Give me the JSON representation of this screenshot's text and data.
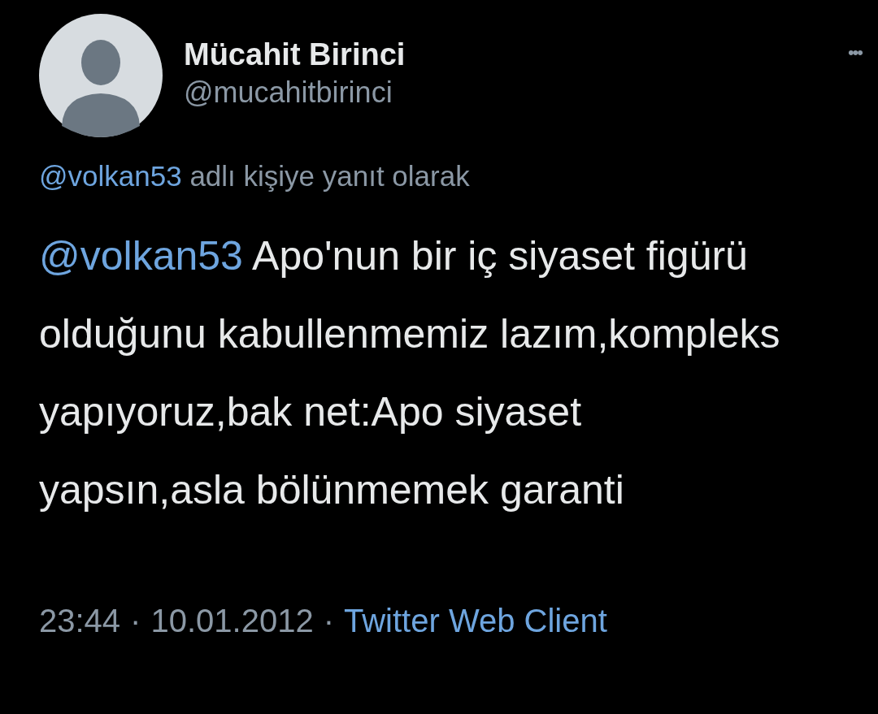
{
  "author": {
    "name": "Mücahit Birinci",
    "handle": "@mucahitbirinci"
  },
  "more": "•••",
  "reply_context": {
    "mention": "@volkan53",
    "text": "adlı kişiye yanıt olarak"
  },
  "tweet": {
    "mention": "@volkan53",
    "text": "Apo'nun bir iç siyaset figürü olduğunu kabullenmemiz lazım,kompleks yapıyoruz,bak net:Apo siyaset yapsın,asla bölünmemek garanti"
  },
  "footer": {
    "time": "23:44",
    "separator": "·",
    "date": "10.01.2012",
    "separator_2": "·",
    "source": "Twitter Web Client"
  }
}
